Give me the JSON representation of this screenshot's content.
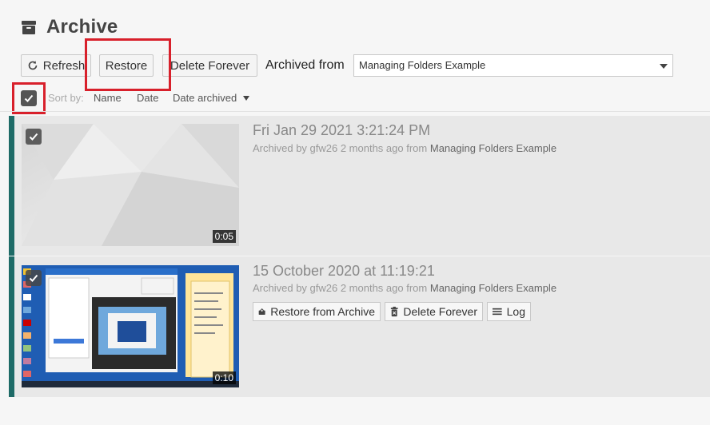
{
  "header": {
    "title": "Archive",
    "icon": "archive-icon"
  },
  "toolbar": {
    "refresh_label": "Refresh",
    "restore_label": "Restore",
    "delete_forever_label": "Delete Forever",
    "archived_from_label": "Archived from",
    "archived_from_value": "Managing Folders Example"
  },
  "sort": {
    "label": "Sort by:",
    "options": [
      "Name",
      "Date",
      "Date archived"
    ],
    "active": "Date archived"
  },
  "items": [
    {
      "title": "Fri Jan 29 2021 3:21:24 PM",
      "meta_prefix": "Archived by gfw26 2 months ago from",
      "meta_source": "Managing Folders Example",
      "duration": "0:05"
    },
    {
      "title": "15 October 2020 at 11:19:21",
      "meta_prefix": "Archived by gfw26 2 months ago from",
      "meta_source": "Managing Folders Example",
      "duration": "0:10",
      "actions": {
        "restore": "Restore from Archive",
        "delete": "Delete Forever",
        "log": "Log"
      }
    }
  ],
  "colors": {
    "accent": "#1e6b67",
    "highlight": "#d8202b"
  }
}
